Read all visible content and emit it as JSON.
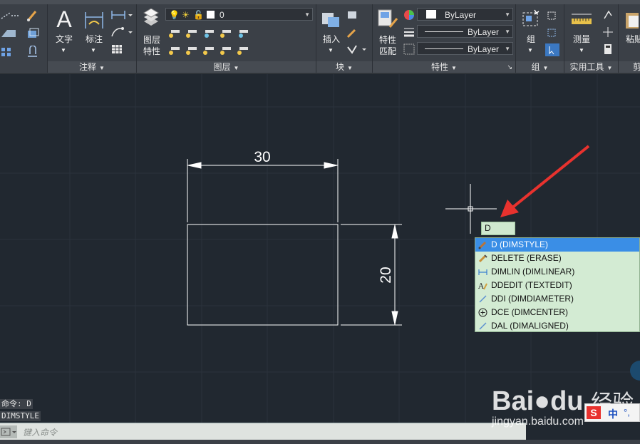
{
  "ribbon": {
    "annotation_panel": {
      "text_label": "文字",
      "dim_label": "标注",
      "title": "注释"
    },
    "layers_panel": {
      "props_label_1": "图层",
      "props_label_2": "特性",
      "layer_name": "0",
      "title": "图层"
    },
    "block_panel": {
      "insert_label": "插入",
      "title": "块"
    },
    "properties_panel": {
      "match_label_1": "特性",
      "match_label_2": "匹配",
      "color": "ByLayer",
      "linetype": "ByLayer",
      "lineweight": "ByLayer",
      "title": "特性"
    },
    "group_panel": {
      "group_label": "组",
      "title": "组"
    },
    "utilities_panel": {
      "measure_label": "测量",
      "title": "实用工具"
    },
    "clipboard_panel": {
      "paste_label": "粘贴",
      "title": "剪"
    }
  },
  "drawing": {
    "dim_horizontal": "30",
    "dim_vertical": "20"
  },
  "autocomplete": {
    "typed": "D",
    "items": [
      {
        "label": "D (DIMSTYLE)",
        "icon": "dimstyle-icon",
        "selected": true
      },
      {
        "label": "DELETE (ERASE)",
        "icon": "erase-icon",
        "selected": false
      },
      {
        "label": "DIMLIN (DIMLINEAR)",
        "icon": "dimlinear-icon",
        "selected": false
      },
      {
        "label": "DDEDIT (TEXTEDIT)",
        "icon": "textedit-icon",
        "selected": false
      },
      {
        "label": "DDI (DIMDIAMETER)",
        "icon": "dimdiameter-icon",
        "selected": false
      },
      {
        "label": "DCE (DIMCENTER)",
        "icon": "dimcenter-icon",
        "selected": false
      },
      {
        "label": "DAL (DIMALIGNED)",
        "icon": "dimaligned-icon",
        "selected": false
      }
    ]
  },
  "command": {
    "history_1": "命令: D",
    "history_2": "DIMSTYLE",
    "placeholder": "键入命令"
  },
  "watermark": {
    "brand": "Bai",
    "brand2": "du",
    "cn": "经验",
    "url": "jingyan.baidu.com"
  },
  "ime": {
    "label": "中"
  },
  "colors": {
    "background": "#212830",
    "selected": "#3a8ee6",
    "arrow": "#e8322e",
    "ac_bg": "#d3ebd3"
  }
}
